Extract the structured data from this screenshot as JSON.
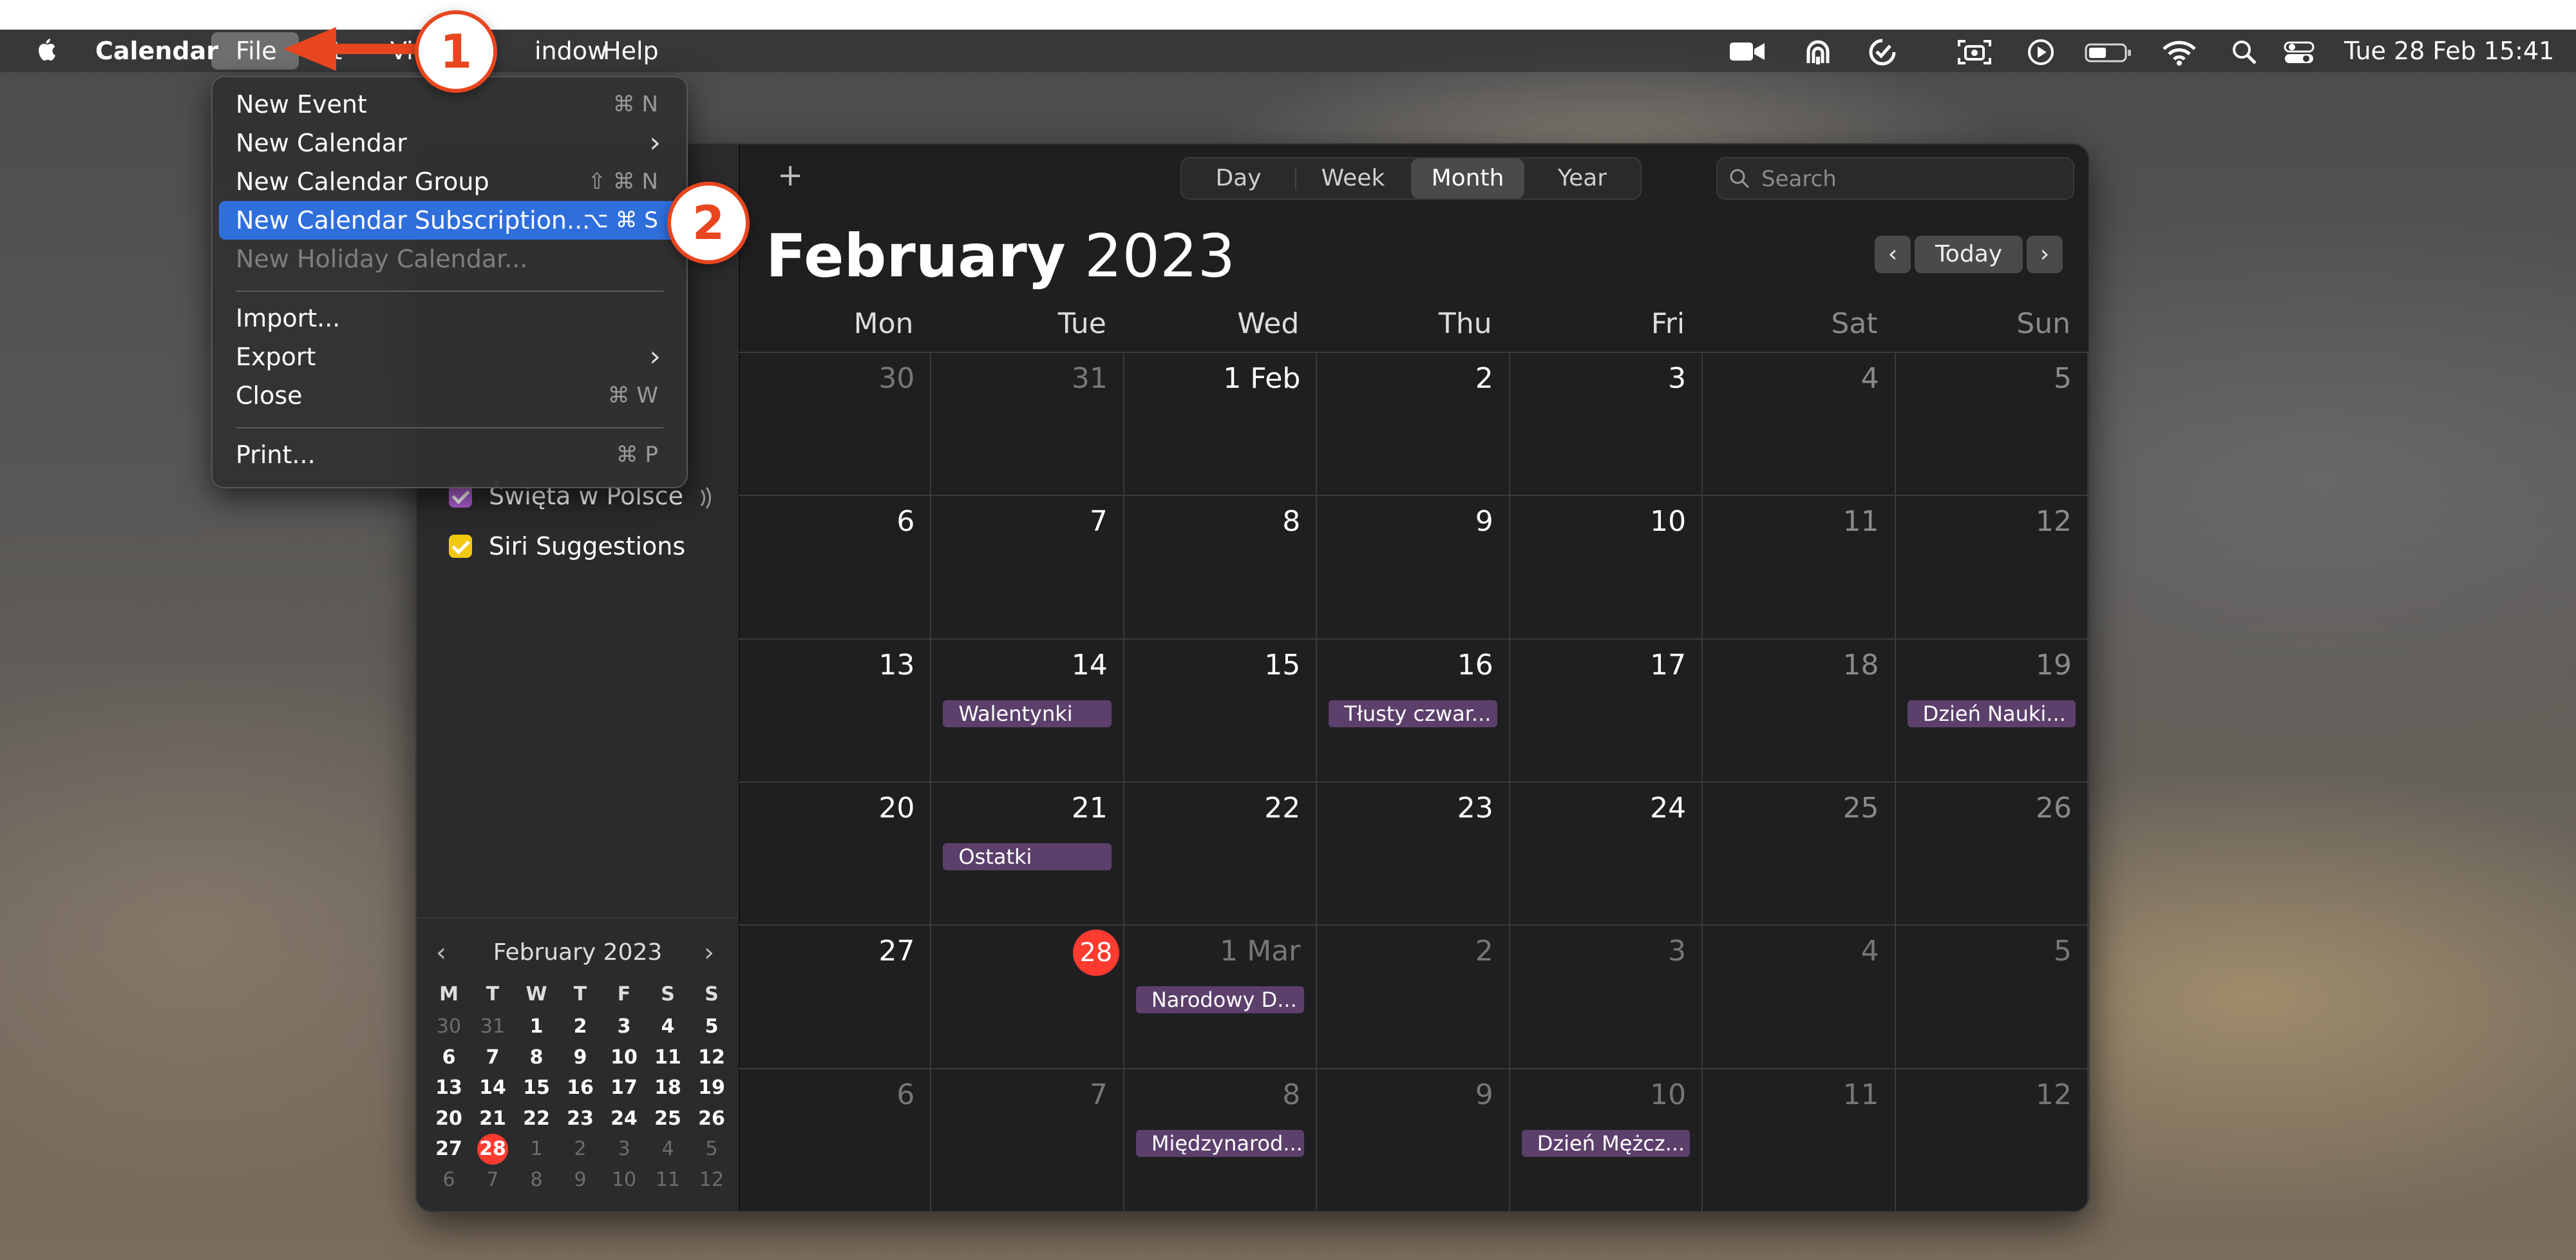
{
  "menubar": {
    "app_name": "Calendar",
    "menus": [
      "File",
      "Edit",
      "View",
      "Window",
      "Help"
    ],
    "visible": {
      "file": "File",
      "edit_tail": "it",
      "view_head": "Vi",
      "window_tail": "indow",
      "help": "Help"
    },
    "clock": "Tue 28 Feb  15:41",
    "status_icons": [
      "facetime-icon",
      "airdrop-icon",
      "focus-icon",
      "screenshot-icon",
      "play-icon",
      "battery-icon",
      "wifi-icon",
      "spotlight-icon",
      "control-center-icon"
    ]
  },
  "file_menu": {
    "items": [
      {
        "label": "New Event",
        "shortcut": "⌘ N"
      },
      {
        "label": "New Calendar",
        "shortcut": ""
      },
      {
        "label": "New Calendar Group",
        "shortcut": "⇧ ⌘ N"
      },
      {
        "label": "New Calendar Subscription...",
        "shortcut": "⌥ ⌘ S"
      },
      {
        "label": "New Holiday Calendar...",
        "shortcut": ""
      },
      {
        "label": "Import...",
        "shortcut": ""
      },
      {
        "label": "Export",
        "shortcut": ""
      },
      {
        "label": "Close",
        "shortcut": "⌘ W"
      },
      {
        "label": "Print...",
        "shortcut": "⌘ P"
      }
    ]
  },
  "annotations": {
    "step1": "1",
    "step2": "2"
  },
  "toolbar": {
    "add_label": "+",
    "views": [
      "Day",
      "Week",
      "Month",
      "Year"
    ],
    "active_view": "Month",
    "search_placeholder": "Search",
    "today_label": "Today",
    "prev": "<",
    "next": ">"
  },
  "header": {
    "month": "February",
    "year": "2023"
  },
  "weekdays": [
    "Mon",
    "Tue",
    "Wed",
    "Thu",
    "Fri",
    "Sat",
    "Sun"
  ],
  "weeks": [
    [
      {
        "d": "30",
        "dim": true
      },
      {
        "d": "31",
        "dim": true
      },
      {
        "d": "1 Feb"
      },
      {
        "d": "2"
      },
      {
        "d": "3"
      },
      {
        "d": "4",
        "we": true
      },
      {
        "d": "5",
        "we": true
      }
    ],
    [
      {
        "d": "6"
      },
      {
        "d": "7"
      },
      {
        "d": "8"
      },
      {
        "d": "9"
      },
      {
        "d": "10"
      },
      {
        "d": "11",
        "we": true
      },
      {
        "d": "12",
        "we": true
      }
    ],
    [
      {
        "d": "13"
      },
      {
        "d": "14",
        "ev": "Walentynki"
      },
      {
        "d": "15"
      },
      {
        "d": "16",
        "ev": "Tłusty czwar..."
      },
      {
        "d": "17"
      },
      {
        "d": "18",
        "we": true
      },
      {
        "d": "19",
        "we": true,
        "ev": "Dzień Nauki..."
      }
    ],
    [
      {
        "d": "20"
      },
      {
        "d": "21",
        "ev": "Ostatki"
      },
      {
        "d": "22"
      },
      {
        "d": "23"
      },
      {
        "d": "24"
      },
      {
        "d": "25",
        "we": true
      },
      {
        "d": "26",
        "we": true
      }
    ],
    [
      {
        "d": "27"
      },
      {
        "d": "28",
        "today": true
      },
      {
        "d": "1 Mar",
        "dim": true,
        "ev": "Narodowy D..."
      },
      {
        "d": "2",
        "dim": true
      },
      {
        "d": "3",
        "dim": true
      },
      {
        "d": "4",
        "dim": true
      },
      {
        "d": "5",
        "dim": true
      }
    ],
    [
      {
        "d": "6",
        "dim": true
      },
      {
        "d": "7",
        "dim": true
      },
      {
        "d": "8",
        "dim": true,
        "ev": "Międzynarod..."
      },
      {
        "d": "9",
        "dim": true
      },
      {
        "d": "10",
        "dim": true,
        "ev": "Dzień Mężcz..."
      },
      {
        "d": "11",
        "dim": true
      },
      {
        "d": "12",
        "dim": true
      }
    ]
  ],
  "sidebar": {
    "calendars": [
      {
        "label": "Święta w Polsce",
        "color": "#b05fd6",
        "broadcast": true
      },
      {
        "label": "Siri Suggestions",
        "color": "#f2c811",
        "broadcast": false
      }
    ]
  },
  "mini_calendar": {
    "title": "February 2023",
    "headers": [
      "M",
      "T",
      "W",
      "T",
      "F",
      "S",
      "S"
    ],
    "weeks": [
      [
        [
          "30",
          1
        ],
        [
          "31",
          1
        ],
        [
          "1",
          0
        ],
        [
          "2",
          0
        ],
        [
          "3",
          0
        ],
        [
          "4",
          0
        ],
        [
          "5",
          0
        ]
      ],
      [
        [
          "6",
          0
        ],
        [
          "7",
          0
        ],
        [
          "8",
          0
        ],
        [
          "9",
          0
        ],
        [
          "10",
          0
        ],
        [
          "11",
          0
        ],
        [
          "12",
          0
        ]
      ],
      [
        [
          "13",
          0
        ],
        [
          "14",
          0
        ],
        [
          "15",
          0
        ],
        [
          "16",
          0
        ],
        [
          "17",
          0
        ],
        [
          "18",
          0
        ],
        [
          "19",
          0
        ]
      ],
      [
        [
          "20",
          0
        ],
        [
          "21",
          0
        ],
        [
          "22",
          0
        ],
        [
          "23",
          0
        ],
        [
          "24",
          0
        ],
        [
          "25",
          0
        ],
        [
          "26",
          0
        ]
      ],
      [
        [
          "27",
          0
        ],
        [
          "28",
          2
        ],
        [
          "1",
          1
        ],
        [
          "2",
          1
        ],
        [
          "3",
          1
        ],
        [
          "4",
          1
        ],
        [
          "5",
          1
        ]
      ],
      [
        [
          "6",
          1
        ],
        [
          "7",
          1
        ],
        [
          "8",
          1
        ],
        [
          "9",
          1
        ],
        [
          "10",
          1
        ],
        [
          "11",
          1
        ],
        [
          "12",
          1
        ]
      ]
    ]
  },
  "colors": {
    "accent": "#2f6fdc",
    "today": "#ff3b30",
    "event": "#5c3f6b",
    "annotation": "#e8461e"
  }
}
